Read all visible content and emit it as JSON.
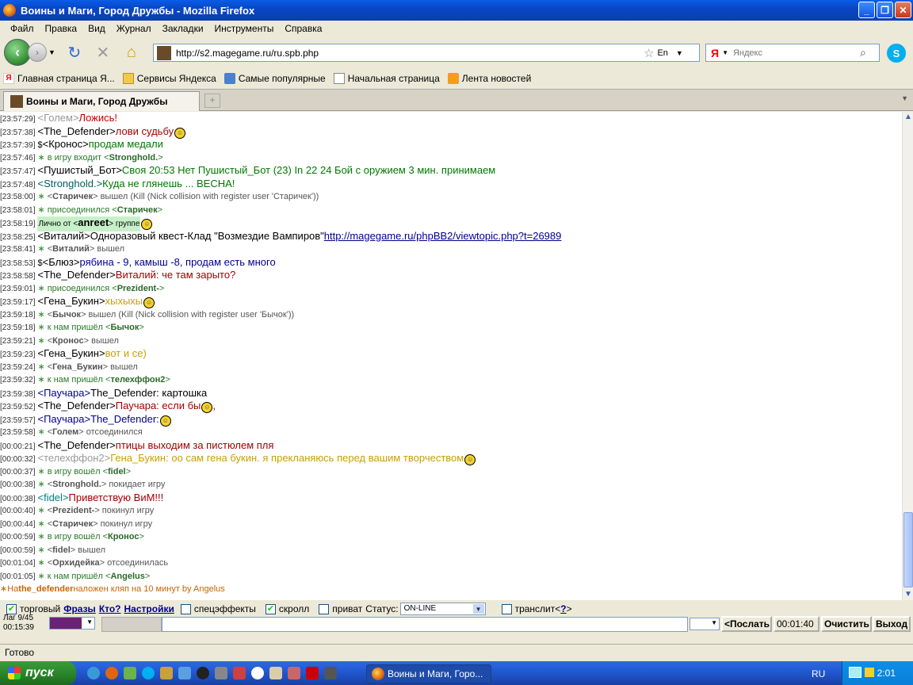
{
  "window": {
    "title": "Воины и Маги, Город Дружбы - Mozilla Firefox"
  },
  "menu": [
    "Файл",
    "Правка",
    "Вид",
    "Журнал",
    "Закладки",
    "Инструменты",
    "Справка"
  ],
  "nav": {
    "url": "http://s2.magegame.ru/ru.spb.php",
    "lang": "En",
    "search_placeholder": "Яндекс",
    "search_engine": "Я"
  },
  "bookmarks": [
    "Главная страница Я...",
    "Сервисы Яндекса",
    "Самые популярные",
    "Начальная страница",
    "Лента новостей"
  ],
  "tab": {
    "title": "Воины и Маги, Город Дружбы",
    "new_tab_symbol": "+"
  },
  "chat": [
    {
      "t": "[23:57:29]",
      "pre": "",
      "nick": "<Голем>",
      "nc": "#999",
      "msg": " Ложись!",
      "mc": "#c00000",
      "big": true,
      "sm": false
    },
    {
      "t": "[23:57:38]",
      "pre": "",
      "nick": "<The_Defender>",
      "nc": "#000",
      "msg": " лови судьбу",
      "mc": "#a00000",
      "big": true,
      "sm": true
    },
    {
      "t": "[23:57:39]",
      "pre": "$",
      "nick": "<Кронос>",
      "nc": "#000",
      "msg": " продам медали",
      "mc": "#007a00",
      "big": true,
      "sm": false
    },
    {
      "t": "[23:57:46]",
      "sys": true,
      "a": "в игру входит <",
      "n": "Stronghold.",
      "b": ">"
    },
    {
      "t": "[23:57:47]",
      "pre": "",
      "nick": "<Пушистый_Бот>",
      "nc": "#000",
      "msg": " Своя 20:53 Нет Пушистый_Бот (23) In 22 24 Бой с оружием 3 мин. принимаем",
      "mc": "#007a00",
      "big": true,
      "sm": false
    },
    {
      "t": "[23:57:48]",
      "pre": "",
      "nick": "<Stronghold.>",
      "nc": "#006060",
      "msg": " Куда не глянешь ... ВЕСНА!",
      "mc": "#007a00",
      "big": true,
      "sm": false
    },
    {
      "t": "[23:58:00]",
      "sys": true,
      "a": "<",
      "n": "Старичек",
      "b": "> вышел (Kill (Nick collision with register user 'Старичек'))",
      "grey": true
    },
    {
      "t": "[23:58:01]",
      "sys": true,
      "a": "присоединился <",
      "n": "Старичек",
      "b": ">"
    },
    {
      "t": "[23:58:19]",
      "pm": true,
      "a": "Лично от <",
      "n": "anreet",
      "b": "> группе",
      "sm": true
    },
    {
      "t": "[23:58:25]",
      "pre": "",
      "nick": "<Виталий>",
      "nc": "#000",
      "msg": " Одноразовый квест-Клад \"Возмездие Вампиров\" ",
      "mc": "#000",
      "big": true,
      "sm": false,
      "link": "http://magegame.ru/phpBB2/viewtopic.php?t=26989"
    },
    {
      "t": "[23:58:41]",
      "sys": true,
      "a": "<",
      "n": "Виталий",
      "b": "> вышел",
      "grey": true
    },
    {
      "t": "[23:58:53]",
      "pre": "$",
      "nick": "<Блюз>",
      "nc": "#000",
      "msg": " рябина - 9, камыш -8, продам есть много",
      "mc": "#00008b",
      "big": true,
      "sm": false
    },
    {
      "t": "[23:58:58]",
      "pre": "",
      "nick": "<The_Defender>",
      "nc": "#000",
      "msg": " Виталий: че там зарыто?",
      "mc": "#a00000",
      "big": true,
      "sm": false
    },
    {
      "t": "[23:59:01]",
      "sys": true,
      "a": "присоединился <",
      "n": "Prezident-",
      "b": ">"
    },
    {
      "t": "[23:59:17]",
      "pre": "",
      "nick": "<Гена_Букин>",
      "nc": "#000",
      "msg": " хыхыхы",
      "mc": "#c8a000",
      "big": true,
      "sm": true
    },
    {
      "t": "[23:59:18]",
      "sys": true,
      "a": "<",
      "n": "Бычок",
      "b": "> вышел (Kill (Nick collision with register user 'Бычок'))",
      "grey": true
    },
    {
      "t": "[23:59:18]",
      "sys": true,
      "a": "к нам пришёл <",
      "n": "Бычок",
      "b": ">"
    },
    {
      "t": "[23:59:21]",
      "sys": true,
      "a": "<",
      "n": "Кронос",
      "b": "> вышел",
      "grey": true
    },
    {
      "t": "[23:59:23]",
      "pre": "",
      "nick": "<Гена_Букин>",
      "nc": "#000",
      "msg": " вот и се)",
      "mc": "#c8a000",
      "big": true,
      "sm": false
    },
    {
      "t": "[23:59:24]",
      "sys": true,
      "a": "<",
      "n": "Гена_Букин",
      "b": "> вышел",
      "grey": true
    },
    {
      "t": "[23:59:32]",
      "sys": true,
      "a": "к нам пришёл <",
      "n": "телехффон2",
      "b": ">"
    },
    {
      "t": "[23:59:38]",
      "pre": "",
      "nick": "<Паучара>",
      "nc": "#00008b",
      "msg": " The_Defender: картошка",
      "mc": "#000",
      "big": true,
      "sm": false
    },
    {
      "t": "[23:59:52]",
      "pre": "",
      "nick": "<The_Defender>",
      "nc": "#000",
      "msg": " Паучара: если бы",
      "mc": "#a00000",
      "big": true,
      "sm": true,
      "after": " ,"
    },
    {
      "t": "[23:59:57]",
      "pre": "",
      "nick": "<Паучара>",
      "nc": "#00008b",
      "msg": " The_Defender: ",
      "mc": "#00008b",
      "big": true,
      "sm": true
    },
    {
      "t": "[23:59:58]",
      "sys": true,
      "a": "<",
      "n": "Голем",
      "b": "> отсоединился",
      "grey": true
    },
    {
      "t": "[00:00:21]",
      "pre": "",
      "nick": "<The_Defender>",
      "nc": "#000",
      "msg": " птицы выходим за пистюлем пля",
      "mc": "#a00000",
      "big": true,
      "sm": false
    },
    {
      "t": "[00:00:32]",
      "pre": "",
      "nick": "<телехффон2>",
      "nc": "#999",
      "msg": " Гена_Букин: оо сам гена букин. я прекланяюсь перед вашим творчеством",
      "mc": "#c8a000",
      "big": true,
      "sm": true
    },
    {
      "t": "[00:00:37]",
      "sys": true,
      "a": "в игру вошёл <",
      "n": "fidel",
      "b": ">"
    },
    {
      "t": "[00:00:38]",
      "sys": true,
      "a": "<",
      "n": "Stronghold.",
      "b": "> покидает игру",
      "grey": true
    },
    {
      "t": "[00:00:38]",
      "pre": "",
      "nick": "<fidel>",
      "nc": "#008080",
      "msg": " Приветствую ВиМ!!!",
      "mc": "#a00000",
      "big": true,
      "sm": false
    },
    {
      "t": "[00:00:40]",
      "sys": true,
      "a": "<",
      "n": "Prezident-",
      "b": "> покинул игру",
      "grey": true
    },
    {
      "t": "[00:00:44]",
      "sys": true,
      "a": "<",
      "n": "Старичек",
      "b": "> покинул игру",
      "grey": true
    },
    {
      "t": "[00:00:59]",
      "sys": true,
      "a": "в игру вошёл <",
      "n": "Кронос",
      "b": ">"
    },
    {
      "t": "[00:00:59]",
      "sys": true,
      "a": "<",
      "n": "fidel",
      "b": "> вышел",
      "grey": true
    },
    {
      "t": "[00:01:04]",
      "sys": true,
      "a": "<",
      "n": "Орхидейка",
      "b": "> отсоединилась",
      "grey": true
    },
    {
      "t": "[00:01:05]",
      "sys": true,
      "a": "к нам пришёл <",
      "n": "Angelus",
      "b": ">"
    }
  ],
  "notice": {
    "a": "На ",
    "n": "the_defender",
    "b": " наложен кляп на 10 минут by Angelus"
  },
  "options": {
    "trade": "торговый",
    "phrases": "Фразы",
    "who": "Кто?",
    "settings": "Настройки",
    "effects": "спецэффекты",
    "scroll": "скролл",
    "private": "приват",
    "status_label": "Статус:",
    "status_value": "ON-LINE",
    "translit": "транслит<",
    "translit_help": "?",
    "translit_end": ">"
  },
  "input": {
    "lag": "Лаг 9/45",
    "time": "00:15:39",
    "send": "<Послать",
    "timer": "00:01:40",
    "clear": "Очистить",
    "exit": "Выход"
  },
  "statusbar": "Готово",
  "taskbar": {
    "start": "пуск",
    "task": "Воины и Маги, Горо...",
    "lang": "RU",
    "clock": "2:01"
  }
}
